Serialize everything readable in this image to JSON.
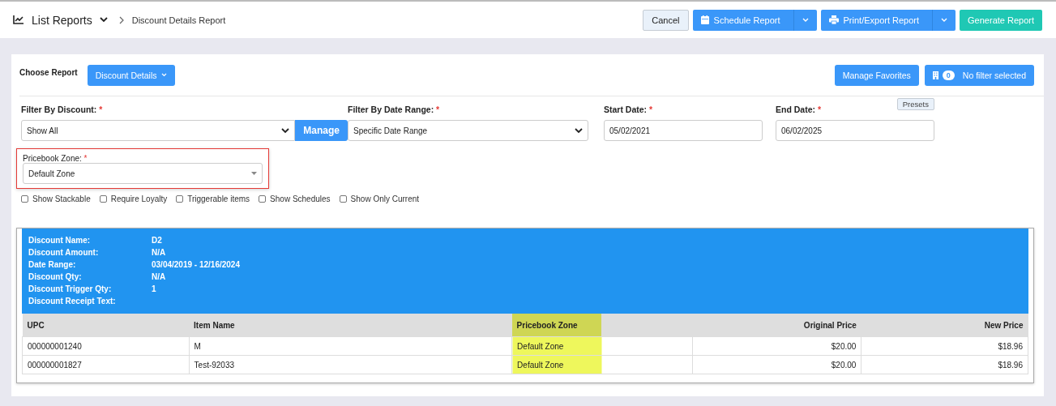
{
  "header": {
    "title": "List Reports",
    "breadcrumb": "Discount Details Report",
    "buttons": [
      {
        "label": "Cancel",
        "kind": "plain",
        "split": false
      },
      {
        "label": "Schedule Report",
        "kind": "primary",
        "split": true
      },
      {
        "label": "Print/Export Report",
        "kind": "primary",
        "split": true
      },
      {
        "label": "Generate Report",
        "kind": "success",
        "split": false
      }
    ]
  },
  "choose_report": {
    "label": "Choose Report",
    "value": "Discount Details"
  },
  "manage_favorites": "Manage Favorites",
  "filter_button": {
    "count": "0",
    "label": "No filter selected"
  },
  "filters": [
    {
      "label": "Filter By Discount:",
      "required_mark": "*",
      "kind": "select",
      "value": "Show All",
      "action": "Manage"
    },
    {
      "label": "Filter By Date Range:",
      "required_mark": "*",
      "kind": "select",
      "value": "Specific Date Range"
    },
    {
      "label": "Start Date:",
      "required_mark": "*",
      "kind": "input",
      "value": "05/02/2021"
    },
    {
      "label": "End Date:",
      "required_mark": "*",
      "kind": "input",
      "value": "06/02/2025",
      "extra": "Presets"
    }
  ],
  "pricebook_zone": {
    "label": "Pricebook Zone:",
    "required_mark": "*",
    "value": "Default Zone",
    "highlighted": true
  },
  "options": [
    {
      "label": "Show Stackable",
      "checked": false
    },
    {
      "label": "Require Loyalty",
      "checked": false
    },
    {
      "label": "Triggerable items",
      "checked": false
    },
    {
      "label": "Show Schedules",
      "checked": false
    },
    {
      "label": "Show Only Current",
      "checked": false
    }
  ],
  "discount_summary": [
    {
      "label": "Discount Name:",
      "value": "D2"
    },
    {
      "label": "Discount Amount:",
      "value": "N/A"
    },
    {
      "label": "Date Range:",
      "value": "03/04/2019 - 12/16/2024"
    },
    {
      "label": "Discount Qty:",
      "value": "N/A"
    },
    {
      "label": "Discount Trigger Qty:",
      "value": "1"
    },
    {
      "label": "Discount Receipt Text:"
    }
  ],
  "table": {
    "columns": [
      {
        "label": "UPC",
        "highlighted": false
      },
      {
        "label": "Item Name",
        "highlighted": false
      },
      {
        "label": "Pricebook Zone",
        "highlighted": true
      },
      {
        "label": "Original Price",
        "highlighted": false
      },
      {
        "label": "New Price",
        "highlighted": false
      }
    ],
    "rows": [
      [
        "000000001240",
        "M",
        "Default Zone",
        "$20.00",
        "$18.96"
      ],
      [
        "000000001827",
        "Test-92033",
        "Default Zone",
        "$20.00",
        "$18.96"
      ]
    ]
  }
}
